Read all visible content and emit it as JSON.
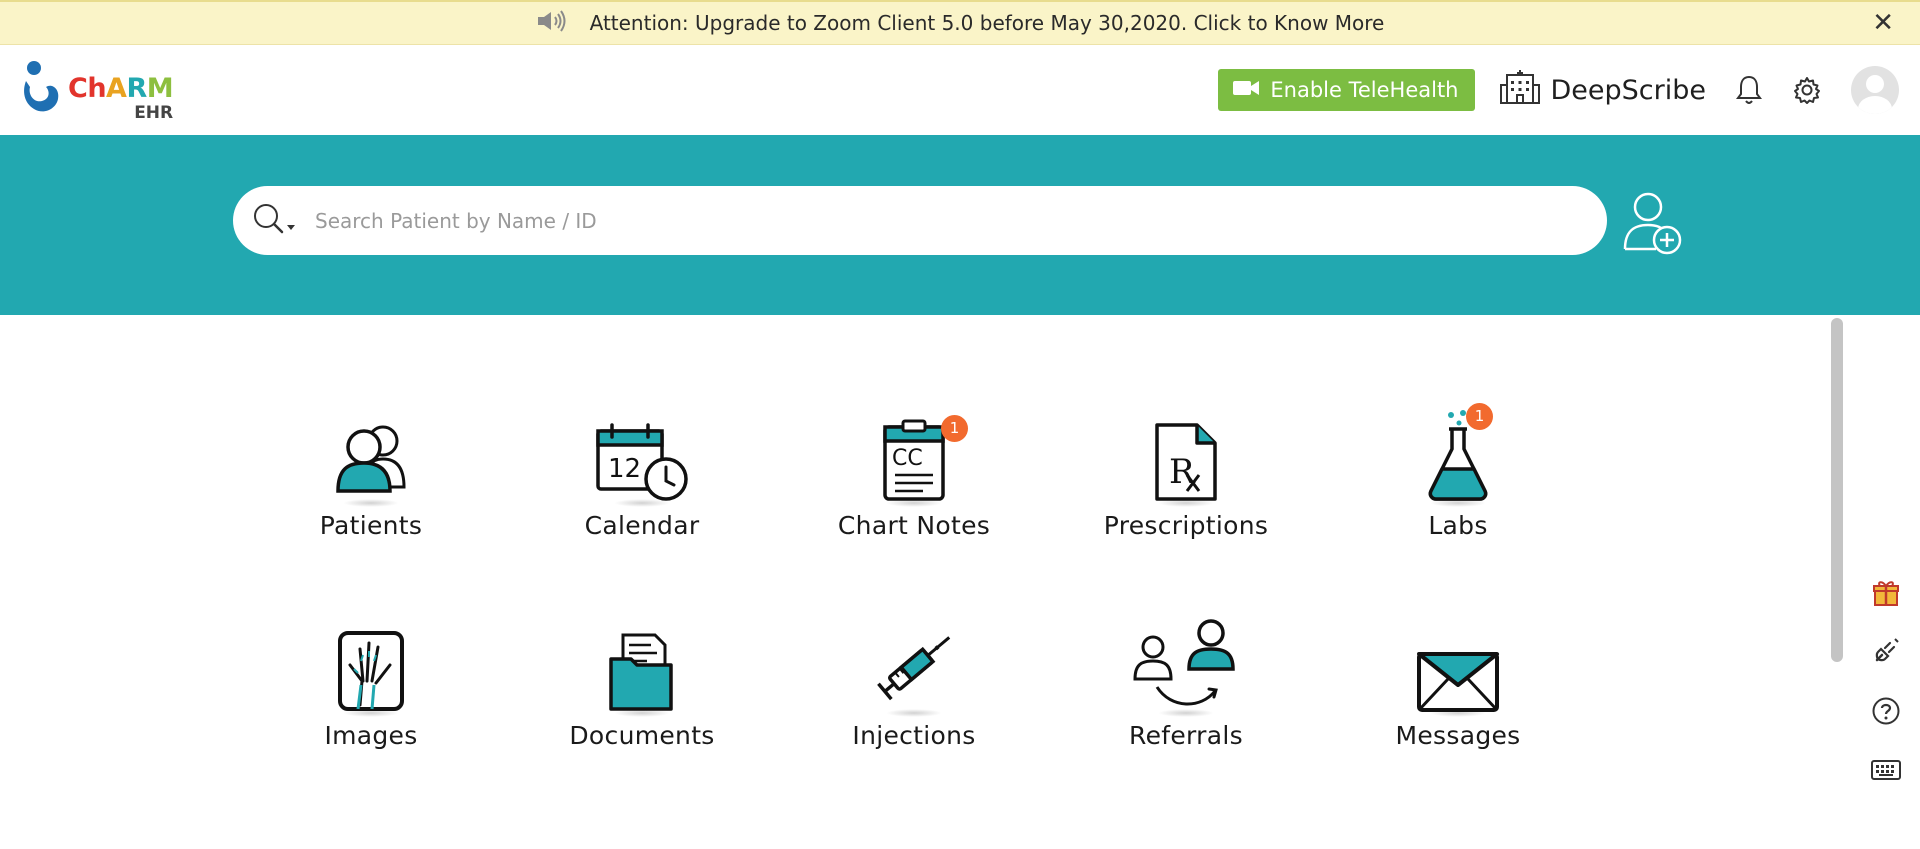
{
  "banner": {
    "message": "Attention: Upgrade to Zoom Client 5.0 before May 30,2020. Click to Know More",
    "icon": "speaker-icon",
    "close_icon": "close-icon"
  },
  "header": {
    "logo": {
      "name": "ChARM",
      "sub": "EHR"
    },
    "telehealth_label": "Enable TeleHealth",
    "practice_name": "DeepScribe"
  },
  "search": {
    "placeholder": "Search Patient by Name / ID"
  },
  "modules": [
    {
      "label": "Patients",
      "icon": "patients-icon"
    },
    {
      "label": "Calendar",
      "icon": "calendar-icon"
    },
    {
      "label": "Chart Notes",
      "icon": "chart-notes-icon",
      "badge": "1"
    },
    {
      "label": "Prescriptions",
      "icon": "prescription-icon"
    },
    {
      "label": "Labs",
      "icon": "lab-flask-icon",
      "badge": "1"
    },
    {
      "label": "Images",
      "icon": "xray-hand-icon"
    },
    {
      "label": "Documents",
      "icon": "folder-icon"
    },
    {
      "label": "Injections",
      "icon": "syringe-icon"
    },
    {
      "label": "Referrals",
      "icon": "referral-icon"
    },
    {
      "label": "Messages",
      "icon": "envelope-icon"
    }
  ],
  "colors": {
    "teal": "#22a8b0",
    "telehealth_green": "#7cbd42",
    "badge_orange": "#f26a2e",
    "banner_yellow": "#faf4c8"
  }
}
